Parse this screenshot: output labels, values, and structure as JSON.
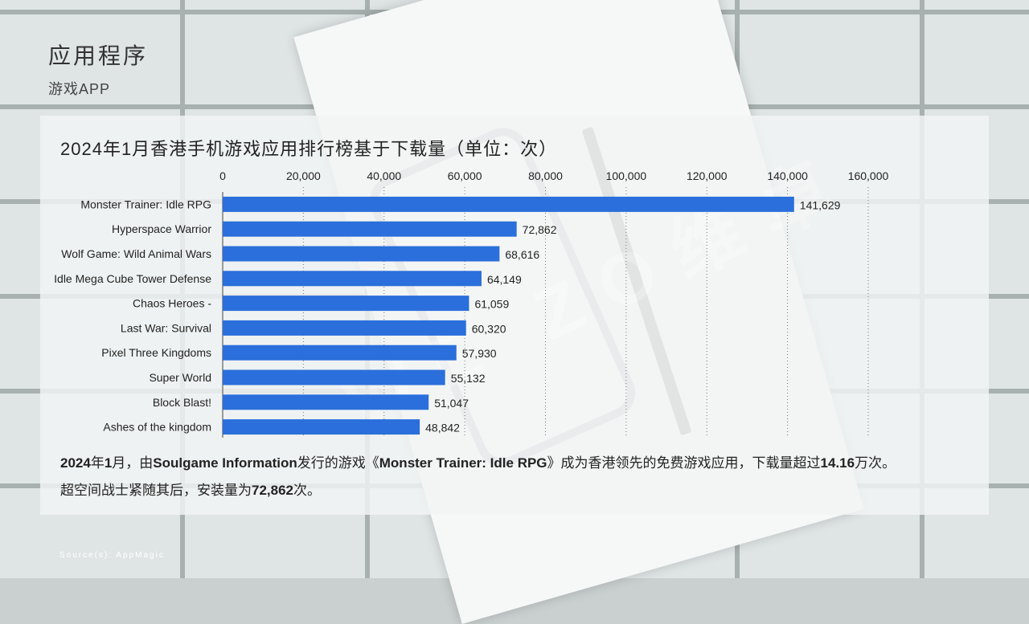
{
  "header": {
    "title": "应用程序",
    "subtitle": "游戏APP"
  },
  "watermark": "WE ZO维卓",
  "chart_data": {
    "type": "bar",
    "orientation": "horizontal",
    "title": "2024年1月香港手机游戏应用排行榜基于下载量（单位：次）",
    "categories": [
      "Monster Trainer: Idle RPG",
      "Hyperspace Warrior",
      "Wolf Game: Wild Animal Wars",
      "Idle Mega Cube Tower Defense",
      "Chaos Heroes -",
      "Last War: Survival",
      "Pixel Three Kingdoms",
      "Super World",
      "Block Blast!",
      "Ashes of the kingdom"
    ],
    "values": [
      141629,
      72862,
      68616,
      64149,
      61059,
      60320,
      57930,
      55132,
      51047,
      48842
    ],
    "value_labels": [
      "141,629",
      "72,862",
      "68,616",
      "64,149",
      "61,059",
      "60,320",
      "57,930",
      "55,132",
      "51,047",
      "48,842"
    ],
    "xlim": [
      0,
      160000
    ],
    "x_ticks": [
      0,
      20000,
      40000,
      60000,
      80000,
      100000,
      120000,
      140000,
      160000
    ],
    "x_tick_labels": [
      "0",
      "20,000",
      "40,000",
      "60,000",
      "80,000",
      "100,000",
      "120,000",
      "140,000",
      "160,000"
    ],
    "x_axis_position": "top",
    "grid": "dotted vertical",
    "bar_color": "#2a6fdb"
  },
  "description": {
    "line1_parts": [
      {
        "t": "2024",
        "b": true
      },
      {
        "t": "年",
        "b": false
      },
      {
        "t": "1",
        "b": true
      },
      {
        "t": "月，由",
        "b": false
      },
      {
        "t": "Soulgame Information",
        "b": true
      },
      {
        "t": "发行的游戏《",
        "b": false
      },
      {
        "t": "Monster Trainer: Idle RPG",
        "b": true
      },
      {
        "t": "》成为香港领先的免费游戏应用，下载量超过",
        "b": false
      },
      {
        "t": "14.16",
        "b": true
      },
      {
        "t": "万次。",
        "b": false
      }
    ],
    "line2_parts": [
      {
        "t": "超空间战士紧随其后，安装量为",
        "b": false
      },
      {
        "t": "72,862",
        "b": true
      },
      {
        "t": "次。",
        "b": false
      }
    ]
  },
  "source": "Source(s): AppMagic"
}
